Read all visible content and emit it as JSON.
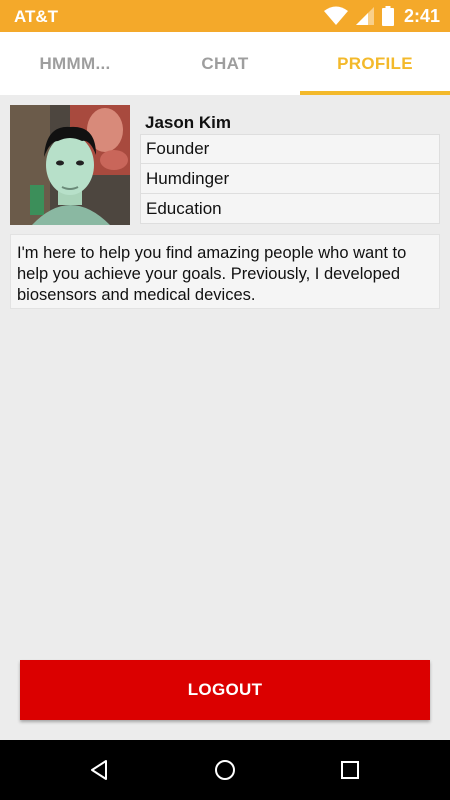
{
  "status_bar": {
    "carrier": "AT&T",
    "time": "2:41",
    "background_color": "#f4a92a",
    "icons": [
      "wifi-icon",
      "signal-icon",
      "battery-icon"
    ]
  },
  "tabs": [
    {
      "label": "HMMM...",
      "active": false
    },
    {
      "label": "CHAT",
      "active": false
    },
    {
      "label": "PROFILE",
      "active": true
    }
  ],
  "accent_color": "#f3b92b",
  "profile": {
    "name": "Jason Kim",
    "details": [
      "Founder",
      "Humdinger",
      "Education"
    ],
    "bio": "I'm here to help you find amazing people who want to help you achieve your goals.  Previously, I developed biosensors and medical devices."
  },
  "logout": {
    "label": "LOGOUT",
    "color": "#db0000"
  },
  "nav_bar": {
    "icons": [
      "back-icon",
      "home-icon",
      "recents-icon"
    ]
  }
}
